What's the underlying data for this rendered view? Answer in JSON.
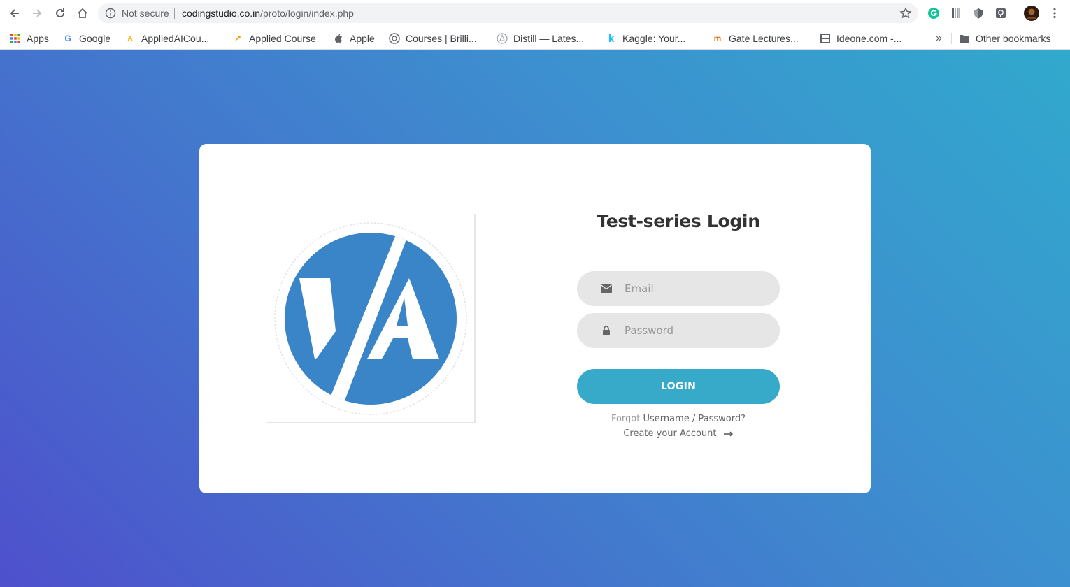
{
  "browser": {
    "omnibox": {
      "security_label": "Not secure",
      "url_host": "codingstudio.co.in",
      "url_path": "/proto/login/index.php"
    },
    "bookmarks": [
      {
        "label": "Apps",
        "icon": "apps-grid-icon"
      },
      {
        "label": "Google",
        "icon": "google-icon"
      },
      {
        "label": "AppliedAICou...",
        "icon": "appliedai-icon"
      },
      {
        "label": "Applied Course",
        "icon": "applied-course-icon"
      },
      {
        "label": "Apple",
        "icon": "apple-icon"
      },
      {
        "label": "Courses | Brilli...",
        "icon": "brilliant-icon"
      },
      {
        "label": "Distill — Lates...",
        "icon": "distill-icon"
      },
      {
        "label": "Kaggle: Your...",
        "icon": "kaggle-icon"
      },
      {
        "label": "Gate Lectures...",
        "icon": "gate-lectures-icon"
      },
      {
        "label": "Ideone.com -...",
        "icon": "ideone-icon"
      }
    ],
    "overflow_label": "»",
    "other_bookmarks": "Other bookmarks"
  },
  "login": {
    "title": "Test-series Login",
    "email_placeholder": "Email",
    "password_placeholder": "Password",
    "login_button": "LOGIN",
    "forgot_prefix": "Forgot",
    "forgot_link": "Username / Password?",
    "create_account": "Create your Account"
  },
  "colors": {
    "gradient_start": "#4e50cc",
    "gradient_end": "#31a9cd",
    "logo_blue": "#3a84c8",
    "button": "#36aac8",
    "field_bg": "#e6e6e6"
  }
}
